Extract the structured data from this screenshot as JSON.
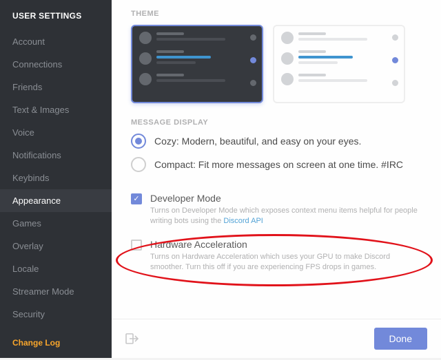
{
  "header": {
    "title": "USER SETTINGS"
  },
  "sidebar": {
    "items": [
      {
        "label": "Account"
      },
      {
        "label": "Connections"
      },
      {
        "label": "Friends"
      },
      {
        "label": "Text & Images"
      },
      {
        "label": "Voice"
      },
      {
        "label": "Notifications"
      },
      {
        "label": "Keybinds"
      },
      {
        "label": "Appearance"
      },
      {
        "label": "Games"
      },
      {
        "label": "Overlay"
      },
      {
        "label": "Locale"
      },
      {
        "label": "Streamer Mode"
      },
      {
        "label": "Security"
      }
    ],
    "active_index": 7,
    "changelog": "Change Log"
  },
  "sections": {
    "theme": {
      "label": "THEME",
      "selected": "dark"
    },
    "message_display": {
      "label": "MESSAGE DISPLAY",
      "options": [
        {
          "label": "Cozy: Modern, beautiful, and easy on your eyes.",
          "selected": true
        },
        {
          "label": "Compact: Fit more messages on screen at one time. #IRC",
          "selected": false
        }
      ]
    }
  },
  "settings": {
    "developer_mode": {
      "title": "Developer Mode",
      "checked": true,
      "desc_pre": "Turns on Developer Mode which exposes context menu items helpful for people writing bots using the ",
      "desc_link": "Discord API"
    },
    "hardware_accel": {
      "title": "Hardware Acceleration",
      "checked": false,
      "desc": "Turns on Hardware Acceleration which uses your GPU to make Discord smoother. Turn this off if you are experiencing FPS drops in games."
    }
  },
  "footer": {
    "done": "Done"
  },
  "annotation": {
    "type": "circle-highlight",
    "target": "hardware-acceleration"
  }
}
